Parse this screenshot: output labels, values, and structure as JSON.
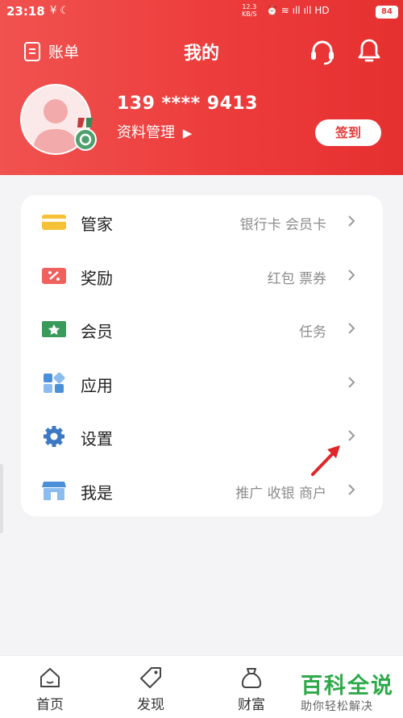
{
  "status_bar": {
    "time": "23:18",
    "left_icons": "¥ ☾",
    "net_speed_value": "12.3",
    "net_speed_unit": "KB/S",
    "right_icons": "⏰ ≋ ıll ıll HD",
    "battery": "84"
  },
  "header": {
    "bill_label": "账单",
    "title": "我的",
    "headset_icon": "headset-icon",
    "bell_icon": "bell-icon"
  },
  "profile": {
    "phone": "139 **** 9413",
    "manage_label": "资料管理",
    "signin_label": "签到"
  },
  "menu": [
    {
      "id": "butler",
      "label": "管家",
      "sub": "银行卡 会员卡",
      "icon": "card-icon",
      "color": "#f5c136"
    },
    {
      "id": "reward",
      "label": "奖励",
      "sub": "红包 票券",
      "icon": "coupon-icon",
      "color": "#f0605c"
    },
    {
      "id": "member",
      "label": "会员",
      "sub": "任务",
      "icon": "member-ticket-icon",
      "color": "#3a9a5a"
    },
    {
      "id": "apps",
      "label": "应用",
      "sub": "",
      "icon": "apps-grid-icon",
      "color": "#4a90d9"
    },
    {
      "id": "settings",
      "label": "设置",
      "sub": "",
      "icon": "gear-icon",
      "color": "#3d78c4"
    },
    {
      "id": "merchant",
      "label": "我是",
      "sub": "推广 收银 商户",
      "icon": "store-icon",
      "color": "#4a90d9"
    }
  ],
  "tabbar": [
    {
      "label": "首页",
      "icon": "home-icon"
    },
    {
      "label": "发现",
      "icon": "tag-icon"
    },
    {
      "label": "财富",
      "icon": "money-bag-icon"
    }
  ],
  "watermark": {
    "line1": "百科全说",
    "line2": "助你轻松解决"
  },
  "colors": {
    "brand_red": "#e63a3a",
    "watermark_green": "#2eaa4a"
  }
}
